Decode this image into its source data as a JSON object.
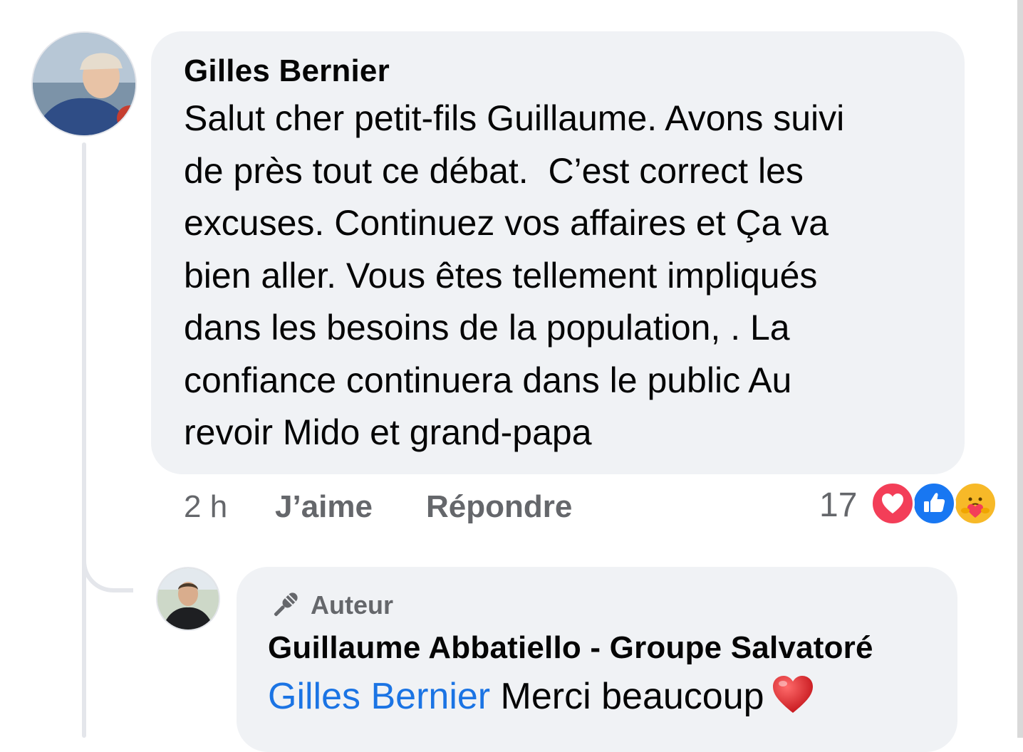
{
  "comment": {
    "author": "Gilles Bernier",
    "text": "Salut cher petit-fils Guillaume. Avons suivi\nde près tout ce débat.  C’est correct les\nexcuses. Continuez vos affaires et Ça va\nbien aller. Vous êtes tellement impliqués\ndans les besoins de la population, . La\nconfiance continuera dans le public Au\nrevoir Mido et grand-papa",
    "time": "2 h",
    "like_label": "J’aime",
    "reply_label": "Répondre",
    "reaction_count": "17",
    "reactions": [
      "love-reaction-icon",
      "like-reaction-icon",
      "care-reaction-icon"
    ]
  },
  "reply": {
    "badge": "Auteur",
    "author": "Guillaume Abbatiello - Groupe Salvatoré",
    "mention": "Gilles Bernier",
    "text": " Merci beaucoup",
    "emoji": "red-heart-emoji"
  },
  "colors": {
    "bubble": "#f0f2f5",
    "mention": "#1b74e4",
    "meta": "#65676b",
    "love": "#f33e58",
    "like": "#1877f2",
    "care": "#f7b928"
  }
}
